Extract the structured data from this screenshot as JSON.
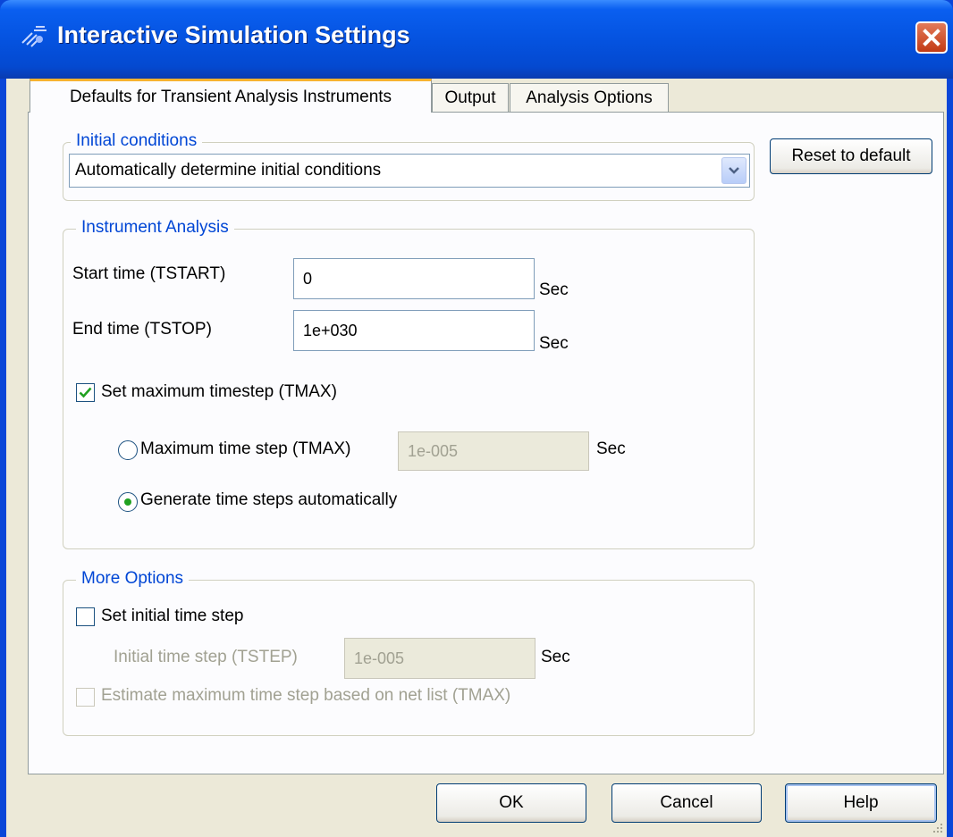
{
  "window": {
    "title": "Interactive Simulation Settings"
  },
  "tabs": [
    {
      "label": "Defaults for Transient Analysis Instruments",
      "active": true
    },
    {
      "label": "Output",
      "active": false
    },
    {
      "label": "Analysis Options",
      "active": false
    }
  ],
  "initial_conditions": {
    "legend": "Initial conditions",
    "selected": "Automatically determine initial conditions"
  },
  "reset_button": "Reset to default",
  "instrument_analysis": {
    "legend": "Instrument Analysis",
    "start_time": {
      "label": "Start time (TSTART)",
      "value": "0",
      "unit": "Sec"
    },
    "end_time": {
      "label": "End time (TSTOP)",
      "value": "1e+030",
      "unit": "Sec"
    },
    "set_max_timestep": {
      "label": "Set maximum timestep (TMAX)",
      "checked": true
    },
    "max_time_step": {
      "label": "Maximum time step (TMAX)",
      "value": "1e-005",
      "unit": "Sec",
      "selected": false
    },
    "auto_steps": {
      "label": "Generate time steps automatically",
      "selected": true
    }
  },
  "more_options": {
    "legend": "More Options",
    "set_initial_step": {
      "label": "Set initial time step",
      "checked": false
    },
    "initial_step": {
      "label": "Initial time step (TSTEP)",
      "value": "1e-005",
      "unit": "Sec"
    },
    "estimate_max": {
      "label": "Estimate maximum time step based on net list (TMAX)",
      "checked": false
    }
  },
  "buttons": {
    "ok": "OK",
    "cancel": "Cancel",
    "help": "Help"
  },
  "colors": {
    "titlebar": "#0553e0",
    "dialog_bg": "#ece9d8",
    "legend_text": "#0046d5",
    "active_tab_accent": "#f7b22f"
  }
}
